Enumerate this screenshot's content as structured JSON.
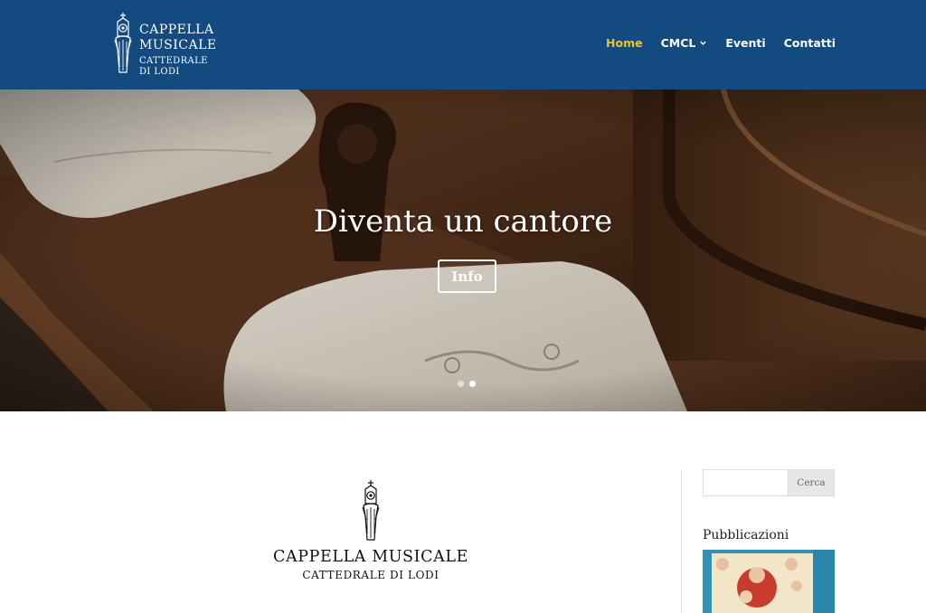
{
  "header": {
    "logo": {
      "line1": "CAPPELLA",
      "line2": "MUSICALE",
      "line3": "CATTEDRALE",
      "line4": "DI LODI"
    },
    "nav": [
      {
        "label": "Home",
        "active": true
      },
      {
        "label": "CMCL",
        "has_dropdown": true
      },
      {
        "label": "Eventi"
      },
      {
        "label": "Contatti"
      }
    ]
  },
  "hero": {
    "title": "Diventa un cantore",
    "button_label": "Info",
    "slide_count": 2,
    "active_slide": 2
  },
  "main": {
    "logo_line1": "CAPPELLA MUSICALE",
    "logo_line2": "CATTEDRALE DI LODI"
  },
  "sidebar": {
    "search": {
      "placeholder": "",
      "button_label": "Cerca"
    },
    "widget_title": "Pubblicazioni"
  },
  "colors": {
    "header_bg": "#134a80",
    "nav_active": "#f0c419",
    "nav_text": "#ffffff"
  }
}
